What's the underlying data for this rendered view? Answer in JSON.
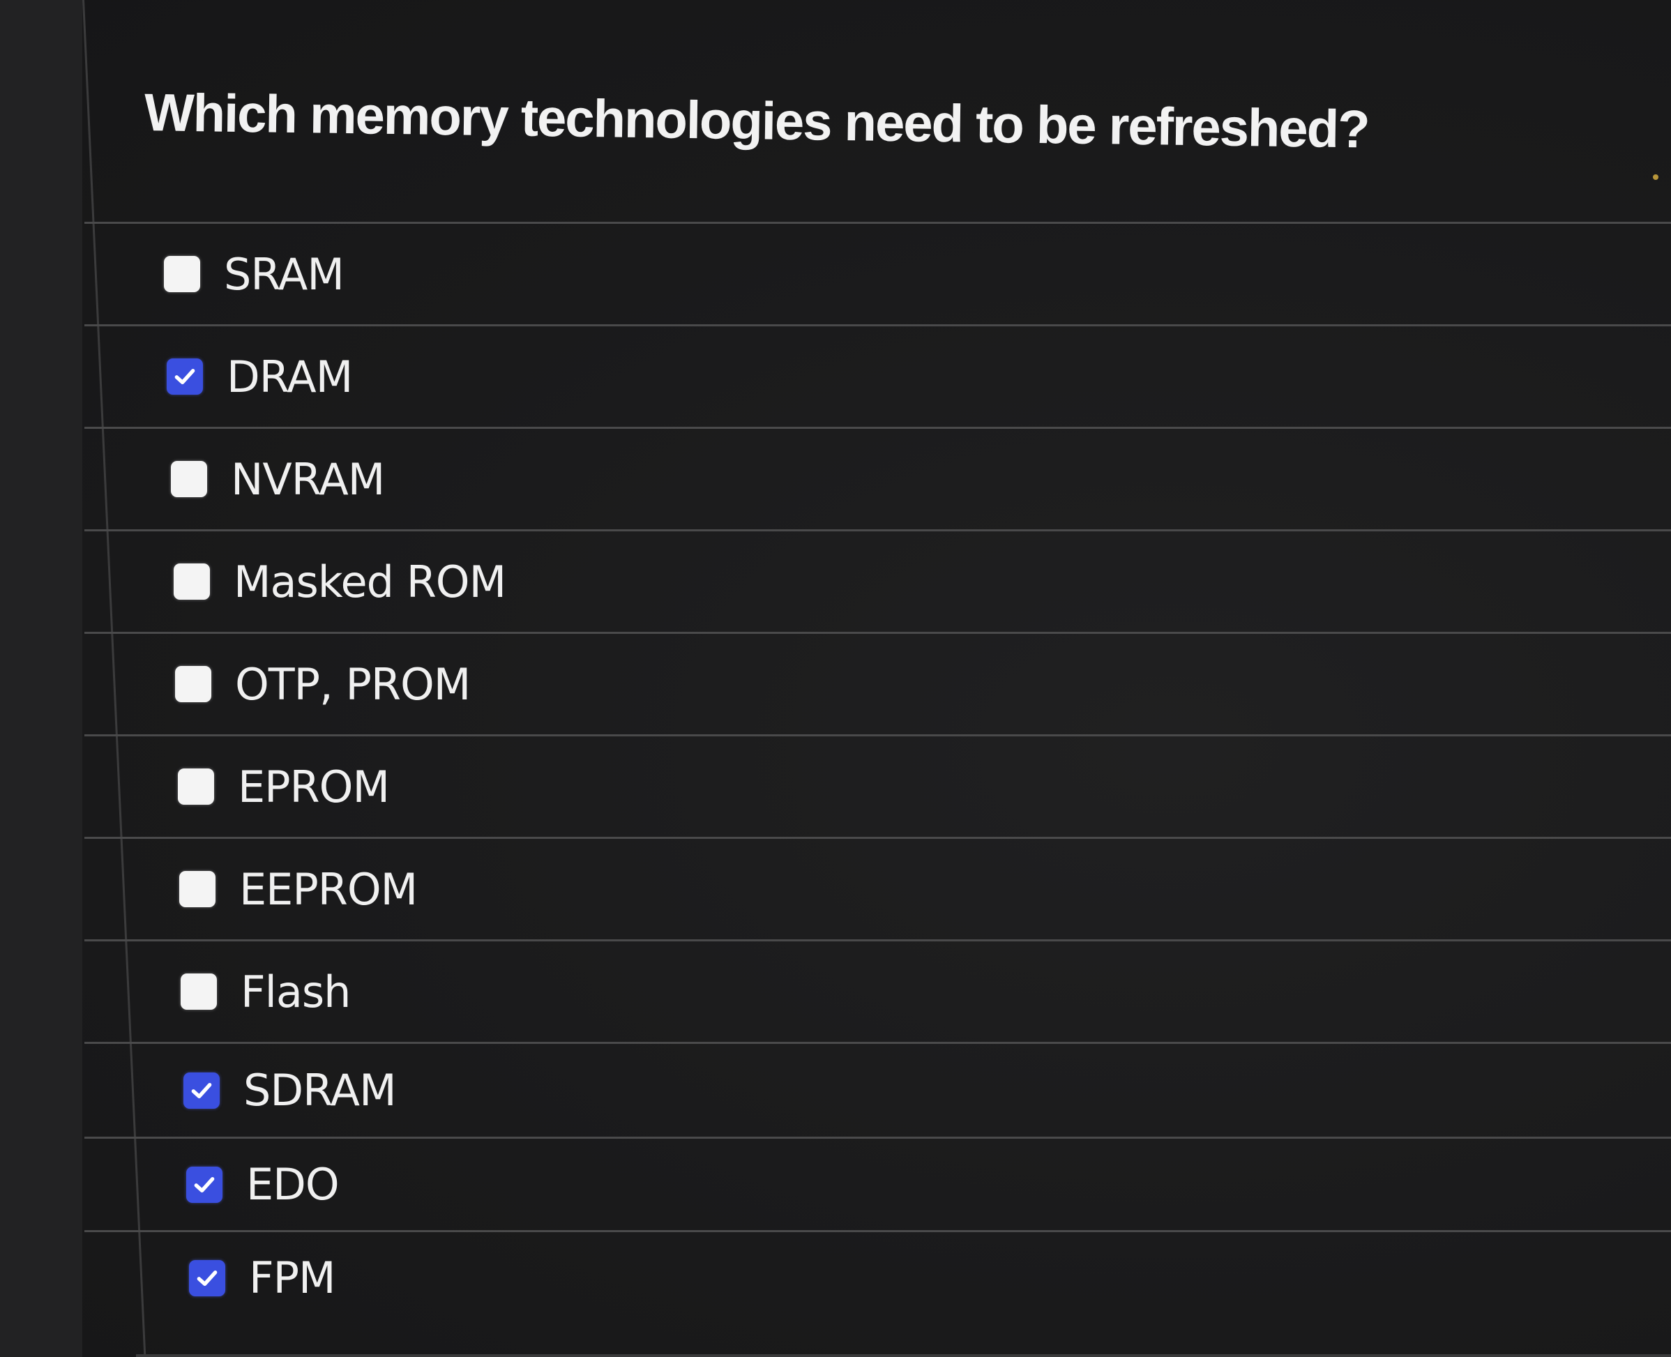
{
  "question": {
    "text": "Which memory technologies need to be refreshed?"
  },
  "options": [
    {
      "label": "SRAM",
      "checked": false
    },
    {
      "label": "DRAM",
      "checked": true
    },
    {
      "label": "NVRAM",
      "checked": false
    },
    {
      "label": "Masked ROM",
      "checked": false
    },
    {
      "label": "OTP, PROM",
      "checked": false
    },
    {
      "label": "EPROM",
      "checked": false
    },
    {
      "label": "EEPROM",
      "checked": false
    },
    {
      "label": "Flash",
      "checked": false
    },
    {
      "label": "SDRAM",
      "checked": true
    },
    {
      "label": "EDO",
      "checked": true
    },
    {
      "label": "FPM",
      "checked": true
    }
  ],
  "colors": {
    "background": "#1b1b1c",
    "checkbox_checked": "#3a4fe0",
    "checkbox_unchecked": "#f4f4f4",
    "divider": "#4a4a4b",
    "text": "#f0f0f0"
  },
  "icons": {
    "checked": "checkmark-icon"
  }
}
